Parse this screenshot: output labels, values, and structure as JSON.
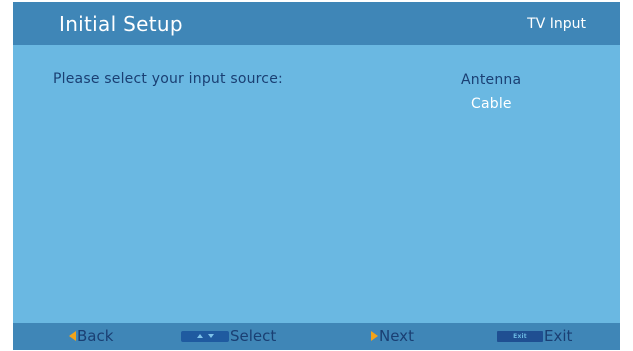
{
  "header": {
    "title": "Initial Setup",
    "context": "TV Input"
  },
  "main": {
    "prompt": "Please select your input source:",
    "options": [
      {
        "label": "Antenna",
        "selected": false
      },
      {
        "label": "Cable",
        "selected": true
      }
    ]
  },
  "footer": {
    "back_label": "Back",
    "select_label": "Select",
    "next_label": "Next",
    "exit_key_label": "Exit",
    "exit_label": "Exit"
  },
  "icons": {
    "back": "arrow-left-icon",
    "select": "up-down-key-icon",
    "next": "arrow-right-icon",
    "exit": "exit-key-icon"
  },
  "colors": {
    "screen_background": "#6ab8e2",
    "bar_background": "#3f86b7",
    "text_dark": "#1a3f73",
    "text_highlight": "#ffffff",
    "arrow_accent": "#f2a318"
  }
}
